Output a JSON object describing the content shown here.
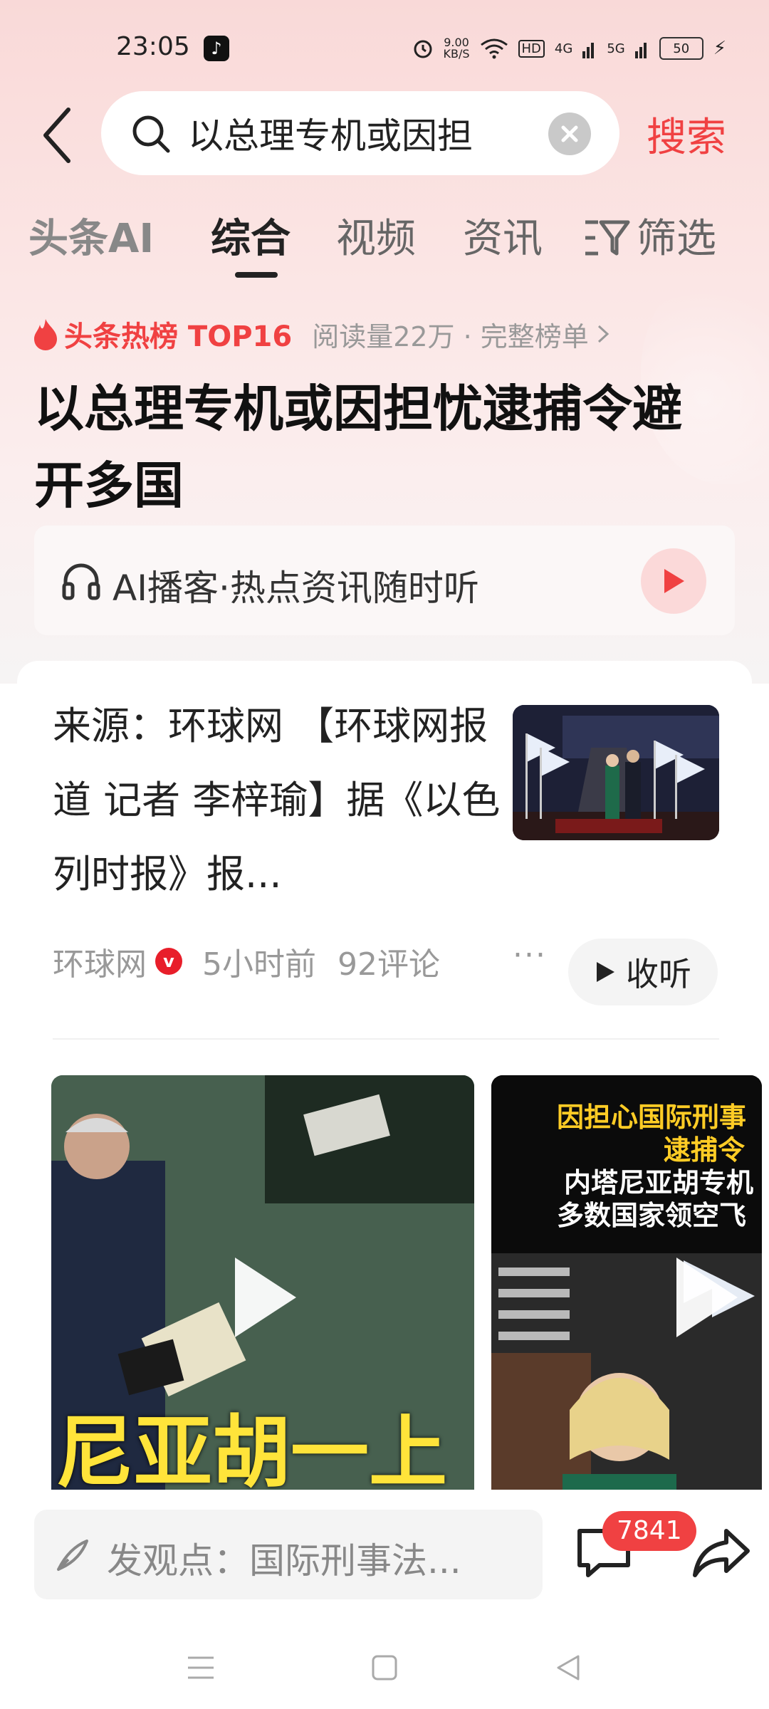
{
  "status": {
    "time": "23:05",
    "net_speed_value": "9.00",
    "net_speed_unit": "KB/S",
    "hd": "HD",
    "net1": "4G",
    "net2": "5G",
    "battery": "50"
  },
  "search": {
    "query": "以总理专机或因担",
    "button": "搜索"
  },
  "tabs": [
    {
      "label": "头条AI"
    },
    {
      "label": "综合"
    },
    {
      "label": "视频"
    },
    {
      "label": "资讯"
    },
    {
      "label": "筛选"
    }
  ],
  "hot": {
    "label": "头条热榜 TOP16",
    "meta": "阅读量22万 · 完整榜单"
  },
  "headline": "以总理专机或因担忧逮捕令避开多国",
  "podcast": {
    "label": "AI播客·热点资讯随时听"
  },
  "article": {
    "snippet": "来源：环球网 【环球网报道 记者 李梓瑜】据《以色列时报》报...",
    "source": "环球网",
    "time": "5小时前",
    "comments": "92评论",
    "listen": "收听"
  },
  "videos": [
    {
      "caption": "尼亚胡一上"
    },
    {
      "caption_line1": "因担心国际刑事",
      "caption_line2": "逮捕令",
      "caption_line3": "内塔尼亚胡专机",
      "caption_line4": "多数国家领空飞"
    }
  ],
  "bottom": {
    "comment_placeholder": "发观点：国际刑事法...",
    "comment_count": "7841"
  },
  "colors": {
    "accent": "#f04142",
    "text": "#222222",
    "muted": "#999999"
  },
  "icons": [
    "back-arrow-icon",
    "search-icon",
    "clear-icon",
    "filter-icon",
    "fire-icon",
    "headphones-icon",
    "play-icon",
    "verified-icon",
    "more-icon",
    "pen-icon",
    "comment-icon",
    "share-icon",
    "menu-icon",
    "home-icon",
    "back-icon"
  ]
}
